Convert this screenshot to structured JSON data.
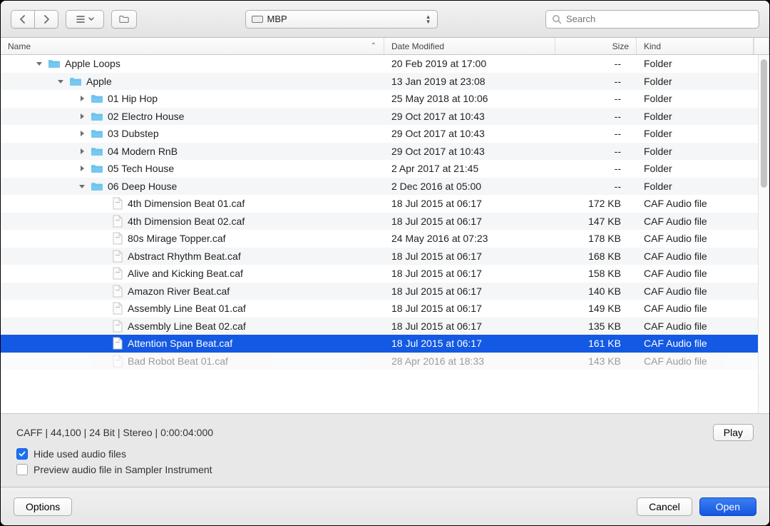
{
  "toolbar": {
    "path_label": "MBP",
    "search_placeholder": "Search"
  },
  "columns": {
    "name": "Name",
    "date": "Date Modified",
    "size": "Size",
    "kind": "Kind"
  },
  "kinds": {
    "folder": "Folder",
    "caf": "CAF Audio file"
  },
  "rows": [
    {
      "depth": 1,
      "type": "folder",
      "expanded": true,
      "name": "Apple Loops",
      "date": "20 Feb 2019 at 17:00",
      "size": "--"
    },
    {
      "depth": 2,
      "type": "folder",
      "expanded": true,
      "name": "Apple",
      "date": "13 Jan 2019 at 23:08",
      "size": "--"
    },
    {
      "depth": 3,
      "type": "folder",
      "expanded": false,
      "name": "01 Hip Hop",
      "date": "25 May 2018 at 10:06",
      "size": "--"
    },
    {
      "depth": 3,
      "type": "folder",
      "expanded": false,
      "name": "02 Electro House",
      "date": "29 Oct 2017 at 10:43",
      "size": "--"
    },
    {
      "depth": 3,
      "type": "folder",
      "expanded": false,
      "name": "03 Dubstep",
      "date": "29 Oct 2017 at 10:43",
      "size": "--"
    },
    {
      "depth": 3,
      "type": "folder",
      "expanded": false,
      "name": "04 Modern RnB",
      "date": "29 Oct 2017 at 10:43",
      "size": "--"
    },
    {
      "depth": 3,
      "type": "folder",
      "expanded": false,
      "name": "05 Tech House",
      "date": "2 Apr 2017 at 21:45",
      "size": "--"
    },
    {
      "depth": 3,
      "type": "folder",
      "expanded": true,
      "name": "06 Deep House",
      "date": "2 Dec 2016 at 05:00",
      "size": "--"
    },
    {
      "depth": 4,
      "type": "file",
      "name": "4th Dimension Beat 01.caf",
      "date": "18 Jul 2015 at 06:17",
      "size": "172 KB"
    },
    {
      "depth": 4,
      "type": "file",
      "name": "4th Dimension Beat 02.caf",
      "date": "18 Jul 2015 at 06:17",
      "size": "147 KB"
    },
    {
      "depth": 4,
      "type": "file",
      "name": "80s Mirage Topper.caf",
      "date": "24 May 2016 at 07:23",
      "size": "178 KB"
    },
    {
      "depth": 4,
      "type": "file",
      "name": "Abstract Rhythm Beat.caf",
      "date": "18 Jul 2015 at 06:17",
      "size": "168 KB"
    },
    {
      "depth": 4,
      "type": "file",
      "name": "Alive and Kicking Beat.caf",
      "date": "18 Jul 2015 at 06:17",
      "size": "158 KB"
    },
    {
      "depth": 4,
      "type": "file",
      "name": "Amazon River Beat.caf",
      "date": "18 Jul 2015 at 06:17",
      "size": "140 KB"
    },
    {
      "depth": 4,
      "type": "file",
      "name": "Assembly Line Beat 01.caf",
      "date": "18 Jul 2015 at 06:17",
      "size": "149 KB"
    },
    {
      "depth": 4,
      "type": "file",
      "name": "Assembly Line Beat 02.caf",
      "date": "18 Jul 2015 at 06:17",
      "size": "135 KB"
    },
    {
      "depth": 4,
      "type": "file",
      "name": "Attention Span Beat.caf",
      "date": "18 Jul 2015 at 06:17",
      "size": "161 KB",
      "selected": true
    },
    {
      "depth": 4,
      "type": "file",
      "name": "Bad Robot Beat 01.caf",
      "date": "28 Apr 2016 at 18:33",
      "size": "143 KB",
      "cut": true
    }
  ],
  "info": {
    "line": "CAFF  |  44,100  |  24 Bit  |  Stereo  |  0:00:04:000",
    "play": "Play",
    "hide_label": "Hide used audio files",
    "hide_checked": true,
    "preview_label": "Preview audio file in Sampler Instrument",
    "preview_checked": false
  },
  "footer": {
    "options": "Options",
    "cancel": "Cancel",
    "open": "Open"
  }
}
